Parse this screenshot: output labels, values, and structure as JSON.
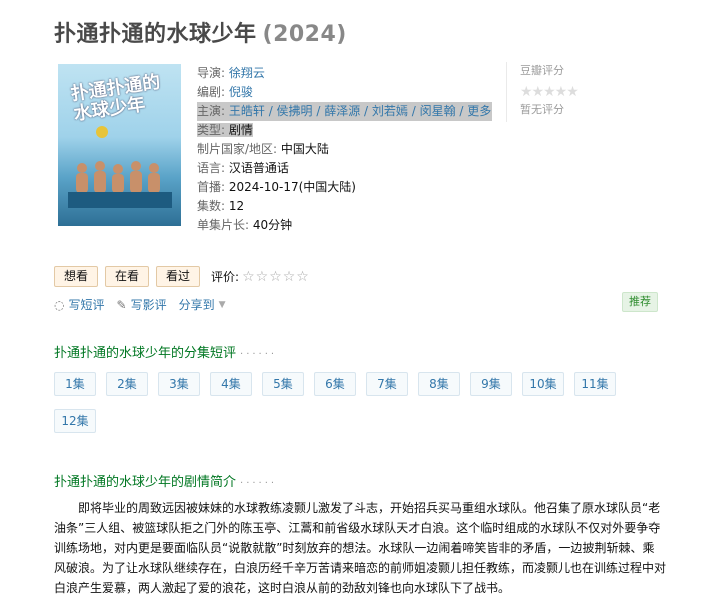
{
  "title": "扑通扑通的水球少年",
  "year": "(2024)",
  "poster_title": "扑通扑通的水球少年",
  "info": {
    "director_label": "导演:",
    "director": "徐翔云",
    "writer_label": "编剧:",
    "writer": "倪骏",
    "cast_label": "主演:",
    "cast": "王皓轩 / 侯拂明 / 薛泽源 / 刘若嫣 / 闵星翰 / 更多...",
    "genre_label": "类型:",
    "genre": "剧情",
    "country_label": "制片国家/地区:",
    "country": "中国大陆",
    "lang_label": "语言:",
    "lang": "汉语普通话",
    "premiere_label": "首播:",
    "premiere": "2024-10-17(中国大陆)",
    "episodes_label": "集数:",
    "episodes": "12",
    "runtime_label": "单集片长:",
    "runtime": "40分钟"
  },
  "rating": {
    "title": "豆瓣评分",
    "none": "暂无评分",
    "stars": "★★★★★"
  },
  "actions": {
    "want": "想看",
    "watching": "在看",
    "watched": "看过",
    "rate_label": "评价:",
    "rate_stars": "☆☆☆☆☆"
  },
  "links": {
    "short_review": "写短评",
    "review": "写影评",
    "share": "分享到",
    "recommend": "推荐",
    "pencil_icon": "✎",
    "chat_icon": "◌"
  },
  "episodes_section": {
    "title": "扑通扑通的水球少年的分集短评",
    "dots": "······",
    "items": [
      "1集",
      "2集",
      "3集",
      "4集",
      "5集",
      "6集",
      "7集",
      "8集",
      "9集",
      "10集",
      "11集",
      "12集"
    ]
  },
  "summary_section": {
    "title": "扑通扑通的水球少年的剧情简介",
    "dots": "······",
    "text": "即将毕业的周致远因被妹妹的水球教练凌颢儿激发了斗志，开始招兵买马重组水球队。他召集了原水球队员“老油条”三人组、被篮球队拒之门外的陈玉亭、江蒿和前省级水球队天才白浪。这个临时组成的水球队不仅对外要争夺训练场地，对内更是要面临队员“说散就散”时刻放弃的想法。水球队一边闹着啼笑皆非的矛盾，一边披荆斩棘、乘风破浪。为了让水球队继续存在，白浪历经千辛万苦请来暗恋的前师姐凌颢儿担任教练，而凌颢儿也在训练过程中对白浪产生爱慕，两人激起了爱的浪花，这时白浪从前的劲敌刘锋也向水球队下了战书。"
  }
}
